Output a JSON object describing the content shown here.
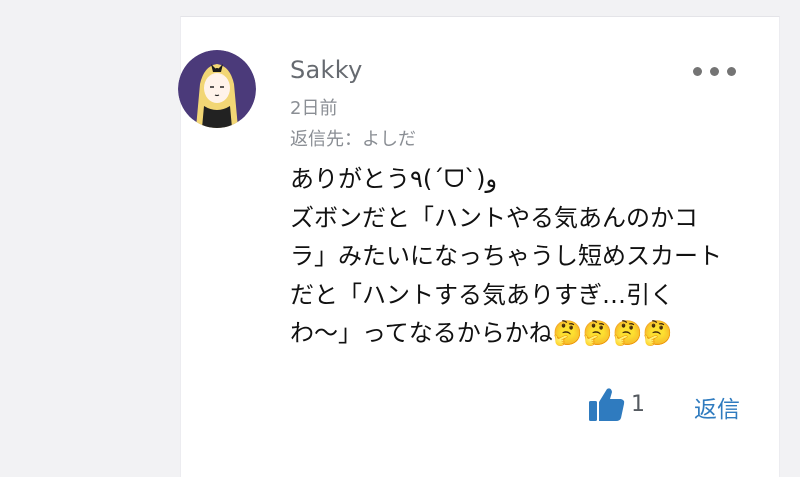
{
  "comment": {
    "author": "Sakky",
    "time_ago": "2日前",
    "reply_to": "返信先：よしだ",
    "text": "ありがとう٩(ˊᗜˋ)و\nズボンだと「ハントやる気あんのかコラ」みたいになっちゃうし短めスカートだと「ハントする気ありすぎ…引くわ〜」ってなるからかね🤔🤔🤔🤔",
    "like_count": "1",
    "reply_label": "返信",
    "more_icon": "more-horizontal-icon",
    "like_icon": "thumbs-up-icon"
  },
  "colors": {
    "accent": "#2f7bbf",
    "like_icon": "#2f7bbf",
    "avatar_bg": "#4b3a7a",
    "hair": "#f2d675"
  }
}
